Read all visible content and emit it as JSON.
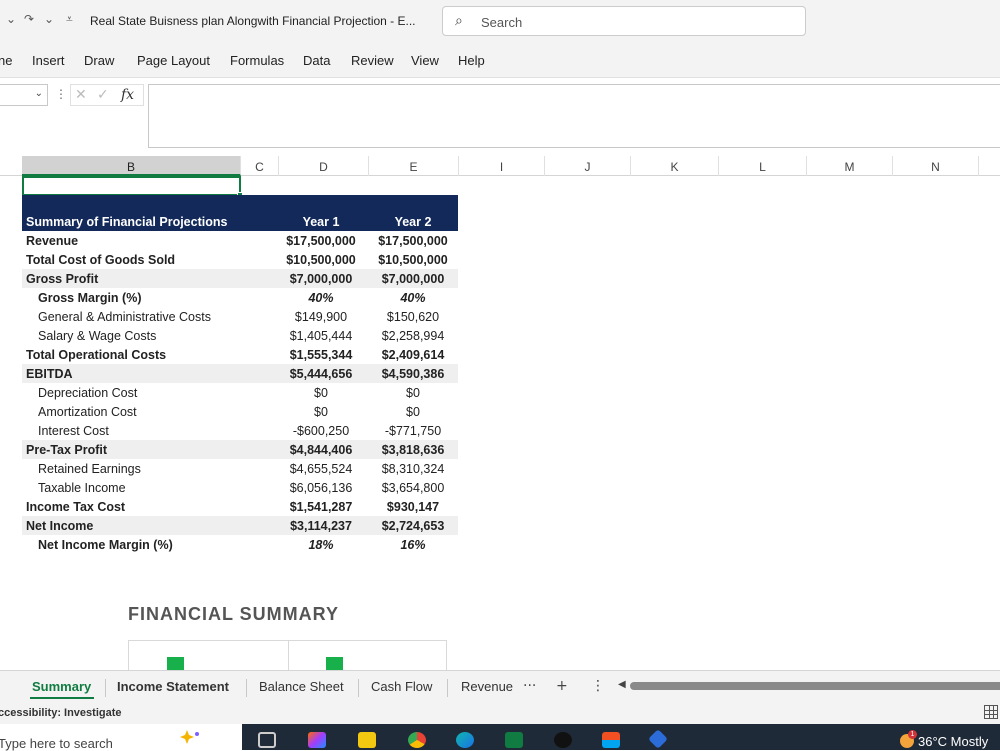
{
  "titlebar": {
    "undo_icon": "undo-icon",
    "redo_icon": "redo-icon",
    "document_title": "Real State Buisness plan Alongwith Financial Projection  -  E...",
    "search_placeholder": "Search"
  },
  "menu": [
    "ne",
    "Insert",
    "Draw",
    "Page Layout",
    "Formulas",
    "Data",
    "Review",
    "View",
    "Help"
  ],
  "formula_bar": {
    "fx": "fx",
    "cancel": "✕",
    "confirm": "✓",
    "value": ""
  },
  "columns": [
    "B",
    "C",
    "D",
    "E",
    "I",
    "J",
    "K",
    "L",
    "M",
    "N"
  ],
  "selected_column": "B",
  "table": {
    "title": "Summary of Financial Projections",
    "year1": "Year 1",
    "year2": "Year 2",
    "rows": [
      {
        "label": "Revenue",
        "y1": "$17,500,000",
        "y2": "$17,500,000",
        "bold": true,
        "indent": false,
        "italic_values": false,
        "alt": false
      },
      {
        "label": "Total Cost of Goods Sold",
        "y1": "$10,500,000",
        "y2": "$10,500,000",
        "bold": true,
        "indent": false,
        "italic_values": false,
        "alt": false
      },
      {
        "label": "Gross Profit",
        "y1": "$7,000,000",
        "y2": "$7,000,000",
        "bold": true,
        "indent": false,
        "italic_values": false,
        "alt": true
      },
      {
        "label": "Gross Margin (%)",
        "y1": "40%",
        "y2": "40%",
        "bold": true,
        "indent": true,
        "italic_values": true,
        "alt": false
      },
      {
        "label": "General & Administrative Costs",
        "y1": "$149,900",
        "y2": "$150,620",
        "bold": false,
        "indent": true,
        "italic_values": false,
        "alt": false
      },
      {
        "label": "Salary & Wage Costs",
        "y1": "$1,405,444",
        "y2": "$2,258,994",
        "bold": false,
        "indent": true,
        "italic_values": false,
        "alt": false
      },
      {
        "label": "Total Operational Costs",
        "y1": "$1,555,344",
        "y2": "$2,409,614",
        "bold": true,
        "indent": false,
        "italic_values": false,
        "alt": false
      },
      {
        "label": "EBITDA",
        "y1": "$5,444,656",
        "y2": "$4,590,386",
        "bold": true,
        "indent": false,
        "italic_values": false,
        "alt": true
      },
      {
        "label": "Depreciation Cost",
        "y1": "$0",
        "y2": "$0",
        "bold": false,
        "indent": true,
        "italic_values": false,
        "alt": false
      },
      {
        "label": "Amortization Cost",
        "y1": "$0",
        "y2": "$0",
        "bold": false,
        "indent": true,
        "italic_values": false,
        "alt": false
      },
      {
        "label": "Interest Cost",
        "y1": "-$600,250",
        "y2": "-$771,750",
        "bold": false,
        "indent": true,
        "italic_values": false,
        "alt": false
      },
      {
        "label": "Pre-Tax Profit",
        "y1": "$4,844,406",
        "y2": "$3,818,636",
        "bold": true,
        "indent": false,
        "italic_values": false,
        "alt": true
      },
      {
        "label": "Retained Earnings",
        "y1": "$4,655,524",
        "y2": "$8,310,324",
        "bold": false,
        "indent": true,
        "italic_values": false,
        "alt": false
      },
      {
        "label": "Taxable Income",
        "y1": "$6,056,136",
        "y2": "$3,654,800",
        "bold": false,
        "indent": true,
        "italic_values": false,
        "alt": false
      },
      {
        "label": "Income Tax Cost",
        "y1": "$1,541,287",
        "y2": "$930,147",
        "bold": true,
        "indent": false,
        "italic_values": false,
        "alt": false
      },
      {
        "label": "Net Income",
        "y1": "$3,114,237",
        "y2": "$2,724,653",
        "bold": true,
        "indent": false,
        "italic_values": false,
        "alt": true
      },
      {
        "label": "Net Income Margin (%)",
        "y1": "18%",
        "y2": "16%",
        "bold": true,
        "indent": true,
        "italic_values": true,
        "alt": false
      }
    ]
  },
  "financial_summary_title": "FINANCIAL SUMMARY",
  "colors": {
    "header_bg": "#12295a",
    "accent": "#107c41",
    "chart_green": "#18b04b"
  },
  "sheet_tabs": [
    "Summary",
    "Income Statement",
    "Balance Sheet",
    "Cash Flow",
    "Revenue"
  ],
  "active_tab": "Summary",
  "tab_controls": {
    "more": "···",
    "add": "+",
    "menu": "⋮"
  },
  "status": {
    "accessibility": "ccessibility: Investigate"
  },
  "taskbar": {
    "search_placeholder": "Type here to search",
    "weather": "36°C  Mostly",
    "weather_badge": "1"
  }
}
